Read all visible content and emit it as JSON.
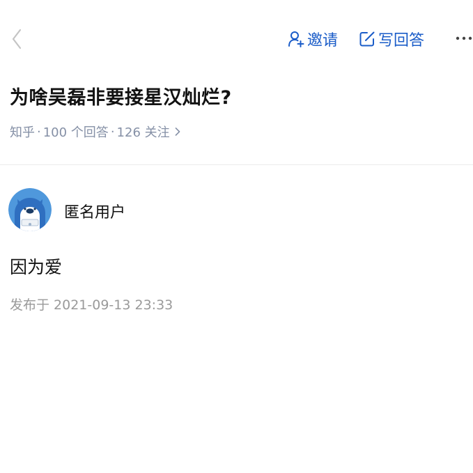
{
  "header": {
    "back_icon": "chevron-left-icon",
    "invite_label": "邀请",
    "invite_icon": "user-add-icon",
    "write_label": "写回答",
    "write_icon": "edit-icon",
    "more_icon": "more-dots-icon",
    "accent_color": "#1a5cc8"
  },
  "question": {
    "title": "为啥吴磊非要接星汉灿烂?",
    "source": "知乎",
    "separator": "·",
    "answers": "100 个回答",
    "followers": "126 关注",
    "chevron_icon": "chevron-right-icon"
  },
  "answer": {
    "author": "匿名用户",
    "avatar_icon": "anonymous-avatar-icon",
    "content": "因为爱",
    "published": "发布于 2021-09-13 23:33"
  }
}
